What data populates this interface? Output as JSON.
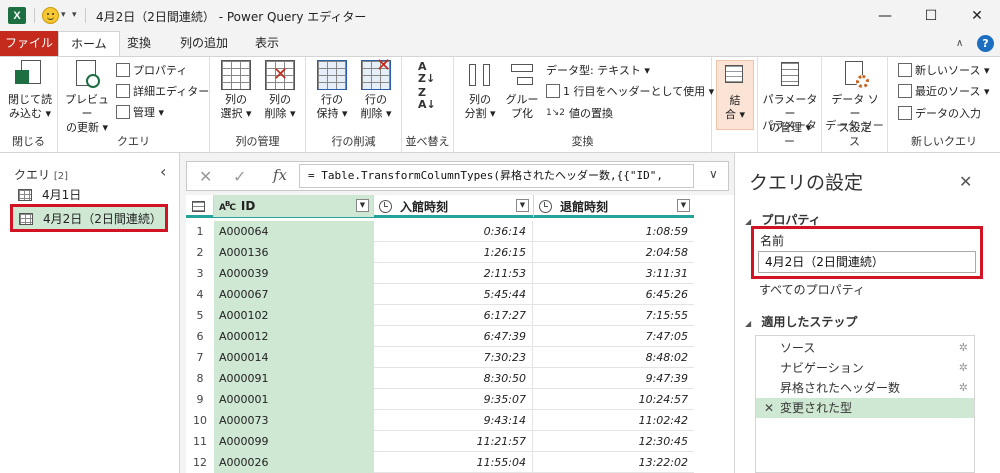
{
  "window": {
    "title": "4月2日（2日間連続） - Power Query エディター",
    "app_logo": "X",
    "minimize": "—",
    "maximize": "☐",
    "close": "✕"
  },
  "tabs": [
    {
      "label": "ファイル"
    },
    {
      "label": "ホーム"
    },
    {
      "label": "変換"
    },
    {
      "label": "列の追加"
    },
    {
      "label": "表示"
    }
  ],
  "ribbon": {
    "close_group": {
      "label": "閉じる",
      "btn1": "閉じて読",
      "btn2": "み込む ▾"
    },
    "query_group": {
      "label": "クエリ",
      "preview1": "プレビュー",
      "preview2": "の更新 ▾",
      "properties": "プロパティ",
      "advanced_editor": "詳細エディター",
      "manage": "管理 ▾"
    },
    "columns_group": {
      "label": "列の管理",
      "select1": "列の",
      "select2": "選択 ▾",
      "remove1": "列の",
      "remove2": "削除 ▾"
    },
    "rows_group": {
      "label": "行の削減",
      "keep1": "行の",
      "keep2": "保持 ▾",
      "remove1": "行の",
      "remove2": "削除 ▾"
    },
    "sort_group": {
      "label": "並べ替え"
    },
    "transform_group": {
      "label": "変換",
      "split1": "列の",
      "split2": "分割 ▾",
      "group1": "グルー",
      "group2": "プ化",
      "datatype": "データ型: テキスト ▾",
      "header": "1 行目をヘッダーとして使用 ▾",
      "replace": "値の置換"
    },
    "combine_group": {
      "label": "",
      "combine1": "結",
      "combine2": "合 ▾"
    },
    "params_group": {
      "label": "パラメーター",
      "manage1": "パラメーター",
      "manage2": "の管理 ▾"
    },
    "datasource_group": {
      "label": "データ ソース",
      "settings1": "データ ソー",
      "settings2": "ス設定"
    },
    "newquery_group": {
      "label": "新しいクエリ",
      "new_source": "新しいソース ▾",
      "recent_sources": "最近のソース ▾",
      "enter_data": "データの入力"
    }
  },
  "queries_pane": {
    "title": "クエリ",
    "count": "[2]",
    "items": [
      {
        "label": "4月1日"
      },
      {
        "label": "4月2日（2日間連続）"
      }
    ]
  },
  "formula_bar": {
    "cancel": "✕",
    "confirm": "✓",
    "fx": "fx",
    "formula": "= Table.TransformColumnTypes(昇格されたヘッダー数,{{\"ID\",",
    "expand": "∨"
  },
  "grid": {
    "columns": [
      {
        "type_icon": "ABC",
        "name": "ID"
      },
      {
        "type_icon": "clock",
        "name": "入館時刻"
      },
      {
        "type_icon": "clock",
        "name": "退館時刻"
      }
    ],
    "rows": [
      {
        "n": "1",
        "id": "A000064",
        "in": "0:36:14",
        "out": "1:08:59"
      },
      {
        "n": "2",
        "id": "A000136",
        "in": "1:26:15",
        "out": "2:04:58"
      },
      {
        "n": "3",
        "id": "A000039",
        "in": "2:11:53",
        "out": "3:11:31"
      },
      {
        "n": "4",
        "id": "A000067",
        "in": "5:45:44",
        "out": "6:45:26"
      },
      {
        "n": "5",
        "id": "A000102",
        "in": "6:17:27",
        "out": "7:15:55"
      },
      {
        "n": "6",
        "id": "A000012",
        "in": "6:47:39",
        "out": "7:47:05"
      },
      {
        "n": "7",
        "id": "A000014",
        "in": "7:30:23",
        "out": "8:48:02"
      },
      {
        "n": "8",
        "id": "A000091",
        "in": "8:30:50",
        "out": "9:47:39"
      },
      {
        "n": "9",
        "id": "A000001",
        "in": "9:35:07",
        "out": "10:24:57"
      },
      {
        "n": "10",
        "id": "A000073",
        "in": "9:43:14",
        "out": "11:02:42"
      },
      {
        "n": "11",
        "id": "A000099",
        "in": "11:21:57",
        "out": "12:30:45"
      },
      {
        "n": "12",
        "id": "A000026",
        "in": "11:55:04",
        "out": "13:22:02"
      }
    ]
  },
  "settings_pane": {
    "title": "クエリの設定",
    "close": "✕",
    "properties_section": "プロパティ",
    "name_label": "名前",
    "name_value": "4月2日（2日間連続）",
    "all_properties": "すべてのプロパティ",
    "steps_section": "適用したステップ",
    "steps": [
      {
        "label": "ソース",
        "gear": "✲"
      },
      {
        "label": "ナビゲーション",
        "gear": "✲"
      },
      {
        "label": "昇格されたヘッダー数",
        "gear": "✲"
      },
      {
        "label": "変更された型",
        "gear": ""
      }
    ]
  },
  "colors": {
    "file_tab": "#c42b1c",
    "highlight_border": "#d21323",
    "selection_green": "#cfe8d3",
    "header_teal": "#23a39a"
  }
}
